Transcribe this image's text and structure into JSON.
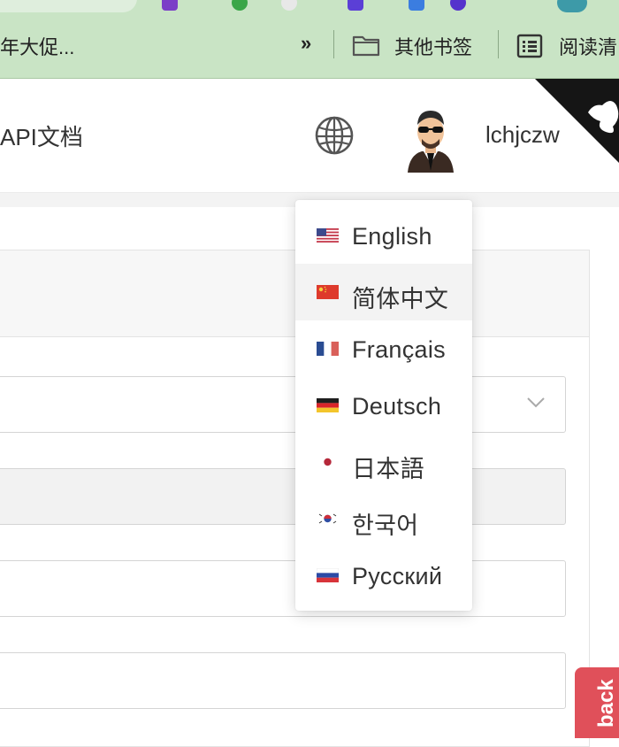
{
  "bookmarks_bar": {
    "left_item": "年大促...",
    "more": "»",
    "other_bookmarks": "其他书签",
    "reading_list": "阅读清"
  },
  "header": {
    "api_docs": "API文档",
    "username": "lchjczw",
    "icons": {
      "language": "globe-icon",
      "user": "avatar",
      "corner": "github-corner-icon"
    }
  },
  "language_menu": {
    "items": [
      {
        "label": "English",
        "flag": "us"
      },
      {
        "label": "简体中文",
        "flag": "cn",
        "active": true
      },
      {
        "label": "Français",
        "flag": "fr"
      },
      {
        "label": "Deutsch",
        "flag": "de"
      },
      {
        "label": "日本語",
        "flag": "jp"
      },
      {
        "label": "한국어",
        "flag": "kr"
      },
      {
        "label": "Русский",
        "flag": "ru"
      }
    ]
  },
  "form": {
    "select_icon": "chevron-down-icon"
  },
  "feedback": {
    "label": "back"
  }
}
